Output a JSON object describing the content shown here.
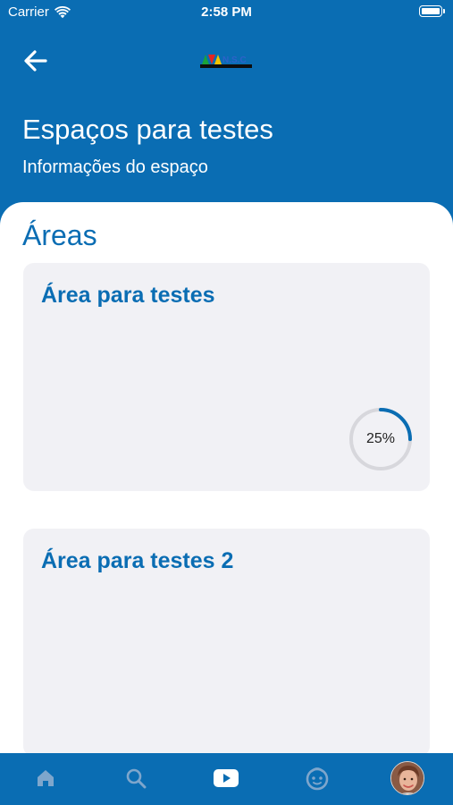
{
  "status_bar": {
    "carrier": "Carrier",
    "time": "2:58 PM"
  },
  "header": {
    "title": "Espaços para testes",
    "subtitle": "Informações do espaço"
  },
  "colors": {
    "primary": "#0a6db3",
    "card_bg": "#f1f1f5",
    "ring_track": "#d7d7dc"
  },
  "main": {
    "section_title": "Áreas",
    "cards": [
      {
        "title": "Área para testes",
        "progress_label": "25%",
        "progress": 0.25
      },
      {
        "title": "Área para testes 2"
      }
    ]
  },
  "tab_bar": {
    "tabs": [
      {
        "icon": "home-icon",
        "active": false
      },
      {
        "icon": "search-icon",
        "active": false
      },
      {
        "icon": "video-icon",
        "active": true
      },
      {
        "icon": "kids-face-icon",
        "active": false
      },
      {
        "icon": "profile-avatar",
        "active": false
      }
    ]
  }
}
